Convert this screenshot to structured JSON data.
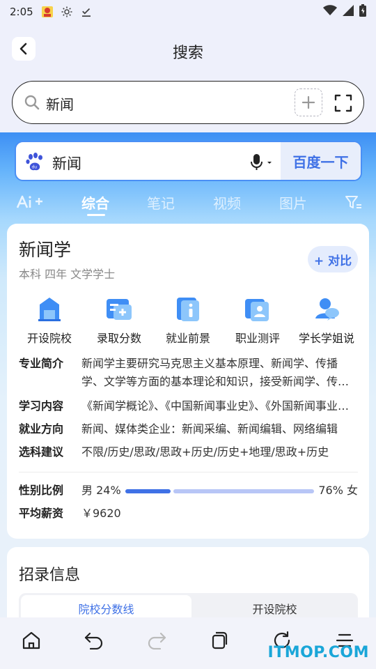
{
  "status_bar": {
    "time": "2:05"
  },
  "nav": {
    "title": "搜索"
  },
  "search": {
    "query": "新闻"
  },
  "baidu": {
    "query": "新闻",
    "button": "百度一下"
  },
  "tabs": [
    {
      "label": "综合",
      "active": true
    },
    {
      "label": "笔记"
    },
    {
      "label": "视频"
    },
    {
      "label": "图片"
    }
  ],
  "major": {
    "title": "新闻学",
    "subtitle": "本科 四年 文学学士",
    "compare": "+ 对比",
    "features": [
      {
        "label": "开设院校",
        "icon": "building-icon"
      },
      {
        "label": "录取分数",
        "icon": "score-icon"
      },
      {
        "label": "就业前景",
        "icon": "job-info-icon"
      },
      {
        "label": "职业测评",
        "icon": "profile-card-icon"
      },
      {
        "label": "学长学姐说",
        "icon": "user-chat-icon"
      }
    ],
    "info": [
      {
        "label": "专业简介",
        "value": "新闻学主要研究马克思主义基本原理、新闻学、传播学、文学等方面的基本理论和知识，接受新闻学、传播学方面的专业训练"
      },
      {
        "label": "学习内容",
        "value": "《新闻学概论》、《中国新闻事业史》、《外国新闻事业史》"
      },
      {
        "label": "就业方向",
        "value": "新闻、媒体类企业：新闻采编、新闻编辑、网络编辑"
      },
      {
        "label": "选科建议",
        "value": "不限/历史/思政/思政+历史/历史+地理/思政+历史"
      }
    ],
    "gender": {
      "label": "性别比例",
      "male_text": "男 24%",
      "female_text": "76% 女",
      "male_percent": 24
    },
    "salary": {
      "label": "平均薪资",
      "value": "￥9620"
    }
  },
  "admission": {
    "title": "招录信息",
    "segments": [
      "院校分数线",
      "开设院校"
    ]
  },
  "watermark": "ITMOP.COM",
  "colors": {
    "accent": "#3f71e6",
    "gradient_top": "#3d8ff4"
  }
}
